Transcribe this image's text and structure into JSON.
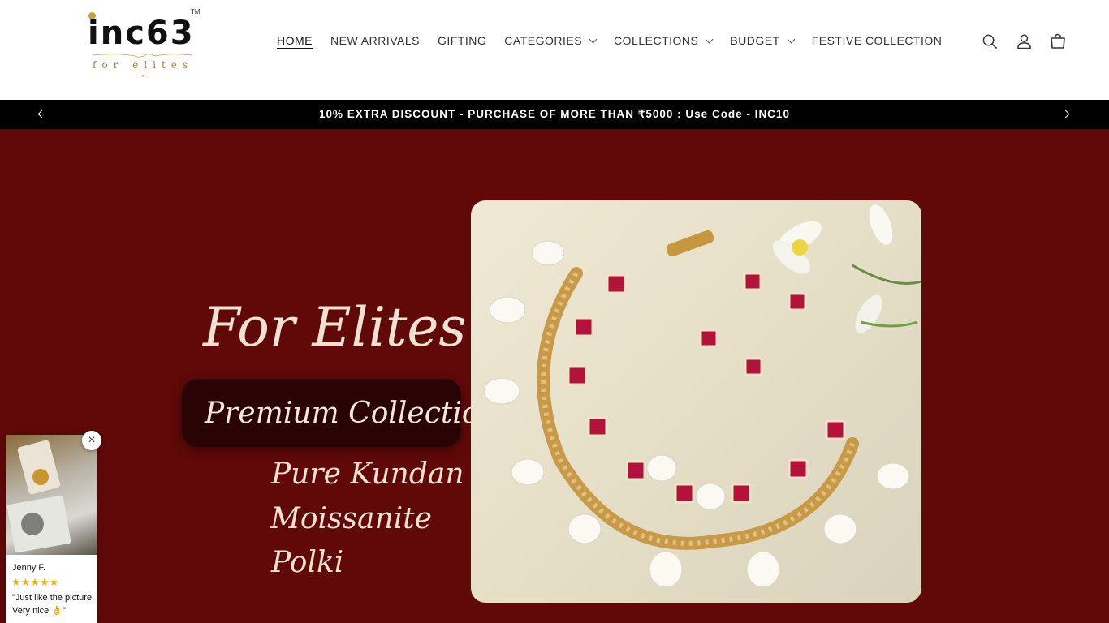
{
  "brand": {
    "logo_text": "inc63",
    "tagline": "for elites",
    "trademark": "TM",
    "accent_gold": "#c9a13b"
  },
  "nav": {
    "items": [
      {
        "label": "HOME",
        "active": true,
        "has_dropdown": false
      },
      {
        "label": "NEW ARRIVALS",
        "active": false,
        "has_dropdown": false
      },
      {
        "label": "GIFTING",
        "active": false,
        "has_dropdown": false
      },
      {
        "label": "CATEGORIES",
        "active": false,
        "has_dropdown": true
      },
      {
        "label": "COLLECTIONS",
        "active": false,
        "has_dropdown": true
      },
      {
        "label": "BUDGET",
        "active": false,
        "has_dropdown": true
      },
      {
        "label": "FESTIVE COLLECTION",
        "active": false,
        "has_dropdown": false
      }
    ]
  },
  "header_icons": [
    "search-icon",
    "account-icon",
    "cart-icon"
  ],
  "announcement": {
    "text": "10% EXTRA DISCOUNT - PURCHASE OF MORE THAN ₹5000 : Use Code - INC10",
    "background": "#000000"
  },
  "hero": {
    "background": "#610909",
    "headline": "For Elites",
    "badge": "Premium Collection",
    "lines": [
      "Pure Kundan",
      "Moissanite",
      "Polki"
    ]
  },
  "review_widget": {
    "name": "Jenny F.",
    "stars": "★★★★★",
    "text": "\"Just like the picture. Very nice 👌\"",
    "close_symbol": "×",
    "rating": 5
  }
}
